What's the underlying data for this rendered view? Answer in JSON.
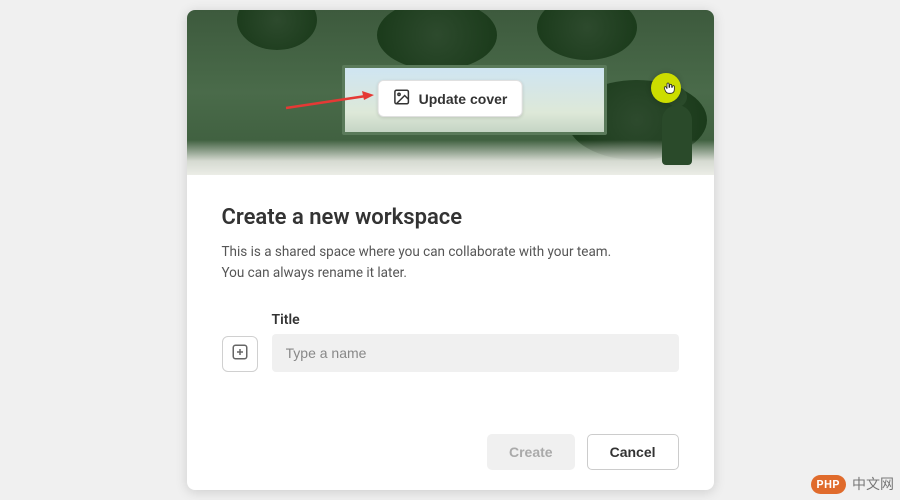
{
  "cover": {
    "update_label": "Update cover"
  },
  "form": {
    "heading": "Create a new workspace",
    "description_line1": "This is a shared space where you can collaborate with your team.",
    "description_line2": "You can always rename it later.",
    "title_label": "Title",
    "title_placeholder": "Type a name",
    "title_value": ""
  },
  "actions": {
    "create_label": "Create",
    "cancel_label": "Cancel"
  },
  "watermark": {
    "badge": "PHP",
    "text": "中文网"
  },
  "colors": {
    "cover_bg": "#3d5a3d",
    "highlight": "#ccdd00",
    "arrow": "#e53935",
    "watermark_badge": "#e06b2c"
  }
}
